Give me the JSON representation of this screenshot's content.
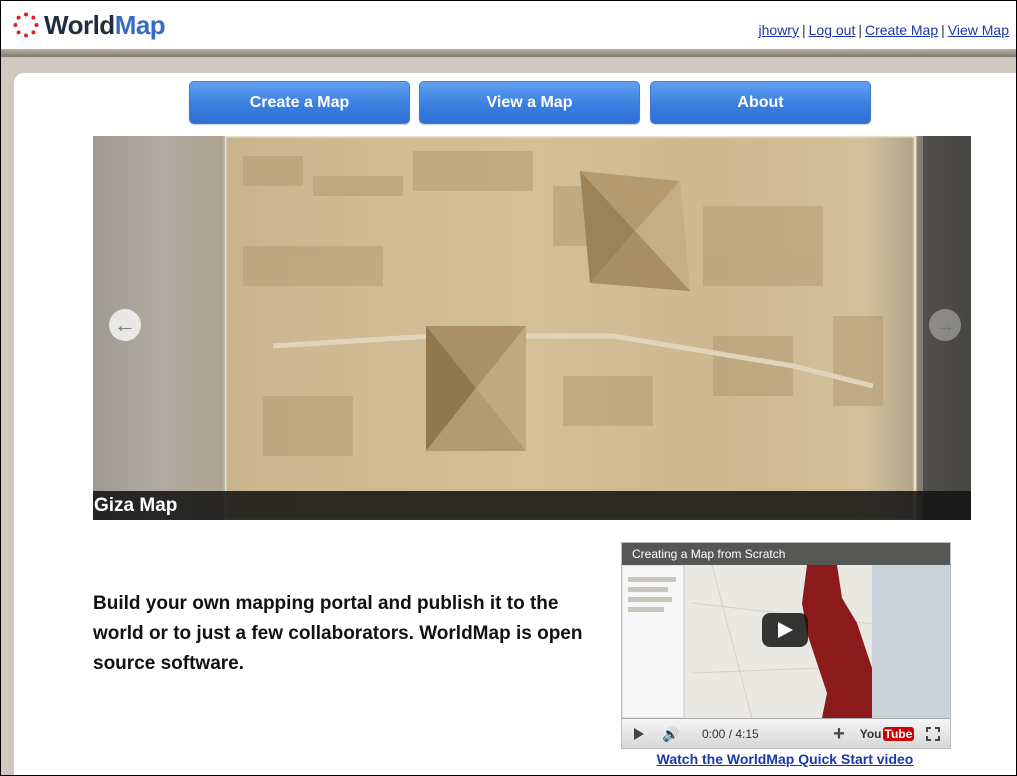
{
  "header": {
    "logo_world": "World",
    "logo_map": "Map",
    "user_links": [
      "jhowry",
      "Log out",
      "Create Map",
      "View Map"
    ]
  },
  "nav": {
    "buttons": [
      "Create a Map",
      "View a Map",
      "About"
    ]
  },
  "slideshow": {
    "caption": "Giza Map",
    "prev_icon": "arrow-left-icon",
    "next_icon": "arrow-right-icon"
  },
  "intro_text": "Build your own mapping portal and publish it to the world or to just a few collaborators. WorldMap is open source software.",
  "video": {
    "title": "Creating a Map from Scratch",
    "time": "0:00 / 4:15",
    "youtube_label_a": "You",
    "youtube_label_b": "Tube",
    "link_text": "Watch the WorldMap Quick Start video"
  },
  "colors": {
    "logo_dots": "#d22",
    "nav_button": "#3a7fe0",
    "link": "#1a38a8",
    "map_overlay": "#8b1a1a"
  }
}
